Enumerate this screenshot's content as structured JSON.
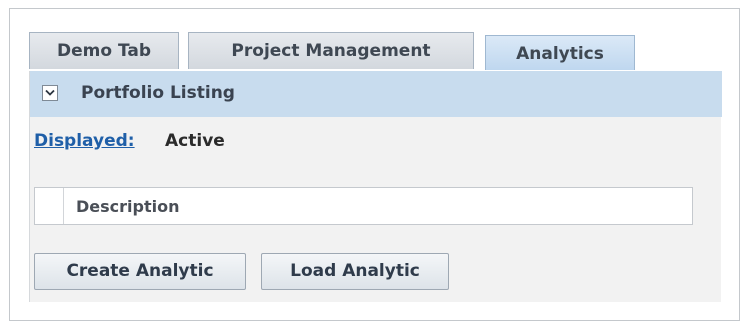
{
  "tabs": [
    {
      "label": "Demo Tab",
      "active": false
    },
    {
      "label": "Project Management",
      "active": false
    },
    {
      "label": "Analytics",
      "active": true
    }
  ],
  "panel": {
    "title": "Portfolio Listing",
    "collapse_icon": "chevron-down-icon"
  },
  "filter": {
    "label": "Displayed:",
    "value": "Active"
  },
  "table": {
    "columns": [
      "Description"
    ]
  },
  "actions": {
    "create_label": "Create Analytic",
    "load_label": "Load Analytic"
  },
  "colors": {
    "header_bg": "#c8dcee",
    "active_tab": "#bfd7ef",
    "link": "#1f5fa8"
  }
}
